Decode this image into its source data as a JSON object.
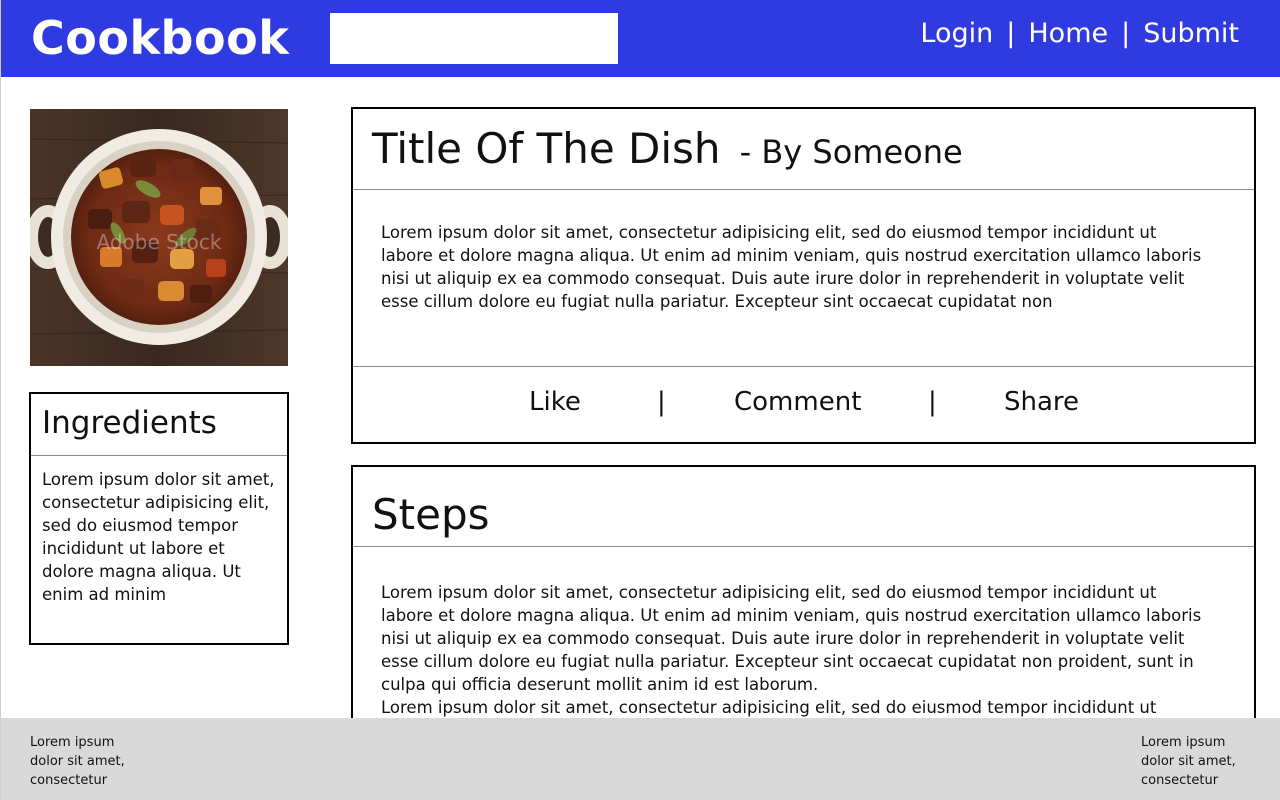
{
  "header": {
    "brand": "Cookbook",
    "search": {
      "value": "",
      "placeholder": ""
    },
    "nav": [
      {
        "label": "Login"
      },
      {
        "label": "Home"
      },
      {
        "label": "Submit"
      }
    ],
    "separator": "|",
    "background_color": "#2f3be0"
  },
  "sidebar": {
    "image": {
      "subject": "beef stew in white bowl",
      "watermark": "Adobe Stock"
    },
    "ingredients": {
      "heading": "Ingredients",
      "text": "Lorem ipsum dolor sit amet, consectetur adipisicing elit, sed do eiusmod tempor incididunt ut labore et dolore magna aliqua. Ut enim ad minim"
    }
  },
  "recipe": {
    "title": "Title Of The Dish",
    "author": "- By Someone",
    "description": "Lorem ipsum dolor sit amet, consectetur adipisicing elit, sed do eiusmod tempor incididunt ut labore et dolore magna aliqua. Ut enim ad minim veniam, quis nostrud exercitation ullamco laboris nisi ut aliquip ex ea commodo consequat. Duis aute irure dolor in reprehenderit in voluptate velit esse cillum dolore eu fugiat nulla pariatur. Excepteur sint occaecat cupidatat non",
    "actions": {
      "like": "Like",
      "comment": "Comment",
      "share": "Share",
      "separator": "|"
    }
  },
  "steps": {
    "heading": "Steps",
    "text": "Lorem ipsum dolor sit amet, consectetur adipisicing elit, sed do eiusmod tempor incididunt ut labore et dolore magna aliqua. Ut enim ad minim veniam, quis nostrud exercitation ullamco laboris nisi ut aliquip ex ea commodo consequat. Duis aute irure dolor in reprehenderit in voluptate velit esse cillum dolore eu fugiat nulla pariatur. Excepteur sint occaecat cupidatat non proident, sunt in culpa qui officia deserunt mollit anim id est laborum.\nLorem ipsum dolor sit amet, consectetur adipisicing elit, sed do eiusmod tempor incididunt ut"
  },
  "footer": {
    "left_text": "Lorem ipsum dolor sit amet, consectetur",
    "right_text": "Lorem ipsum dolor sit amet, consectetur",
    "background_color": "#d9d9d9"
  }
}
